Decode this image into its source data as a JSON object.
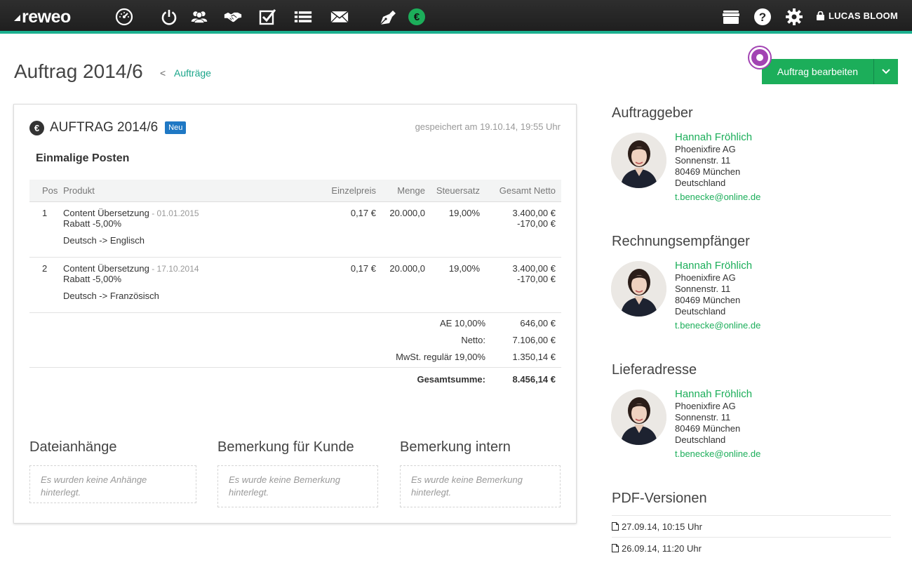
{
  "app": {
    "logo": "reweo",
    "user": "LUCAS BLOOM"
  },
  "nav": [
    "dashboard-icon",
    "power-icon",
    "contacts-icon",
    "handshake-icon",
    "tasks-icon",
    "list-icon",
    "mail-icon",
    "pen-icon",
    "euro-icon"
  ],
  "header": {
    "title": "Auftrag 2014/6",
    "breadcrumb": "Aufträge",
    "edit_button": "Auftrag bearbeiten"
  },
  "order": {
    "title": "AUFTRAG 2014/6",
    "badge": "Neu",
    "saved": "gespeichert am 19.10.14, 19:55 Uhr",
    "section": "Einmalige Posten",
    "columns": [
      "Pos",
      "Produkt",
      "Einzelpreis",
      "Menge",
      "Steuersatz",
      "Gesamt Netto"
    ],
    "items": [
      {
        "pos": "1",
        "product": "Content Übersetzung",
        "date": " - 01.01.2015",
        "unit_price": "0,17 €",
        "qty": "20.000,0",
        "tax": "19,00%",
        "net": "3.400,00 €",
        "discount": "Rabatt -5,00%",
        "discount_value": "-170,00 €",
        "language": "Deutsch -> Englisch"
      },
      {
        "pos": "2",
        "product": "Content Übersetzung",
        "date": " - 17.10.2014",
        "unit_price": "0,17 €",
        "qty": "20.000,0",
        "tax": "19,00%",
        "net": "3.400,00 €",
        "discount": "Rabatt -5,00%",
        "discount_value": "-170,00 €",
        "language": "Deutsch -> Französisch"
      }
    ],
    "totals": [
      {
        "label": "AE 10,00%",
        "value": "646,00 €"
      },
      {
        "label": "Netto:",
        "value": "7.106,00 €"
      },
      {
        "label": "MwSt. regulär 19,00%",
        "value": "1.350,14 €"
      }
    ],
    "grand_total": {
      "label": "Gesamtsumme:",
      "value": "8.456,14 €"
    },
    "attachments": {
      "title": "Dateianhänge",
      "empty": "Es wurden keine Anhänge hinterlegt."
    },
    "note_customer": {
      "title": "Bemerkung für Kunde",
      "empty": "Es wurde keine Bemerkung hinterlegt."
    },
    "note_internal": {
      "title": "Bemerkung intern",
      "empty": "Es wurde keine Bemerkung hinterlegt."
    }
  },
  "sidebar": {
    "client": {
      "heading": "Auftraggeber",
      "name": "Hannah Fröhlich",
      "company": "Phoenixfire AG",
      "street": "Sonnenstr. 11",
      "city": "80469 München",
      "country": "Deutschland",
      "email": "t.benecke@online.de"
    },
    "billing": {
      "heading": "Rechnungsempfänger",
      "name": "Hannah Fröhlich",
      "company": "Phoenixfire AG",
      "street": "Sonnenstr. 11",
      "city": "80469 München",
      "country": "Deutschland",
      "email": "t.benecke@online.de"
    },
    "shipping": {
      "heading": "Lieferadresse",
      "name": "Hannah Fröhlich",
      "company": "Phoenixfire AG",
      "street": "Sonnenstr. 11",
      "city": "80469 München",
      "country": "Deutschland",
      "email": "t.benecke@online.de"
    },
    "pdf": {
      "heading": "PDF-Versionen",
      "versions": [
        "27.09.14, 10:15 Uhr",
        "26.09.14, 11:20 Uhr"
      ]
    }
  },
  "colors": {
    "accent": "#1cae5a",
    "teal": "#1bb08f",
    "badge": "#1f78c4",
    "marker": "#a243b3"
  }
}
